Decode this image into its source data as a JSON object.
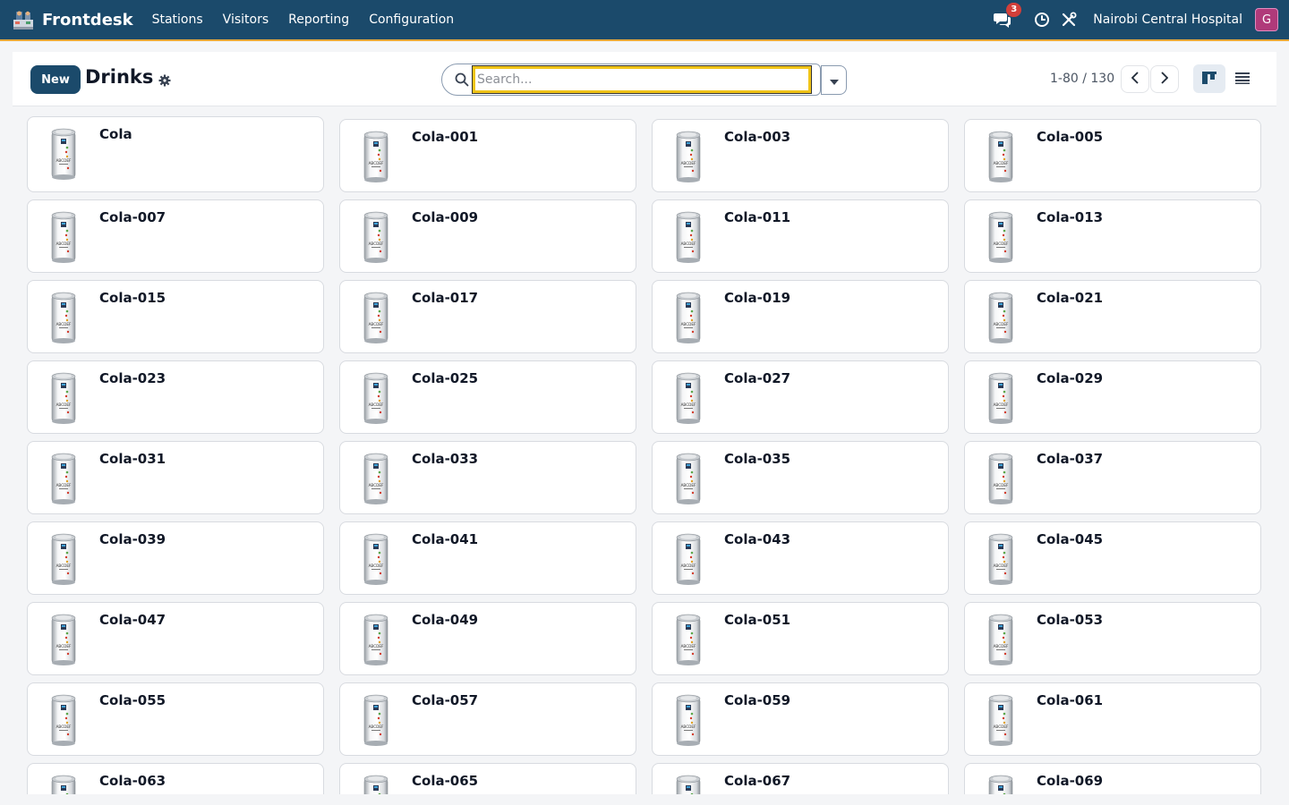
{
  "navbar": {
    "app_name": "Frontdesk",
    "menu": [
      "Stations",
      "Visitors",
      "Reporting",
      "Configuration"
    ],
    "messages_count": "3",
    "company": "Nairobi Central Hospital",
    "avatar_initial": "G",
    "icons": [
      "chat-icon",
      "clock-icon",
      "tools-icon"
    ]
  },
  "control": {
    "new_label": "New",
    "title": "Drinks",
    "search_placeholder": "Search...",
    "pager": "1-80 / 130"
  },
  "products": [
    "Cola",
    "Cola-001",
    "Cola-003",
    "Cola-005",
    "Cola-007",
    "Cola-009",
    "Cola-011",
    "Cola-013",
    "Cola-015",
    "Cola-017",
    "Cola-019",
    "Cola-021",
    "Cola-023",
    "Cola-025",
    "Cola-027",
    "Cola-029",
    "Cola-031",
    "Cola-033",
    "Cola-035",
    "Cola-037",
    "Cola-039",
    "Cola-041",
    "Cola-043",
    "Cola-045",
    "Cola-047",
    "Cola-049",
    "Cola-051",
    "Cola-053",
    "Cola-055",
    "Cola-057",
    "Cola-059",
    "Cola-061",
    "Cola-063",
    "Cola-065",
    "Cola-067",
    "Cola-069"
  ],
  "colors": {
    "navbar": "#1b4a6b",
    "accent_line": "#e8a838",
    "search_focus": "#f0c419"
  }
}
